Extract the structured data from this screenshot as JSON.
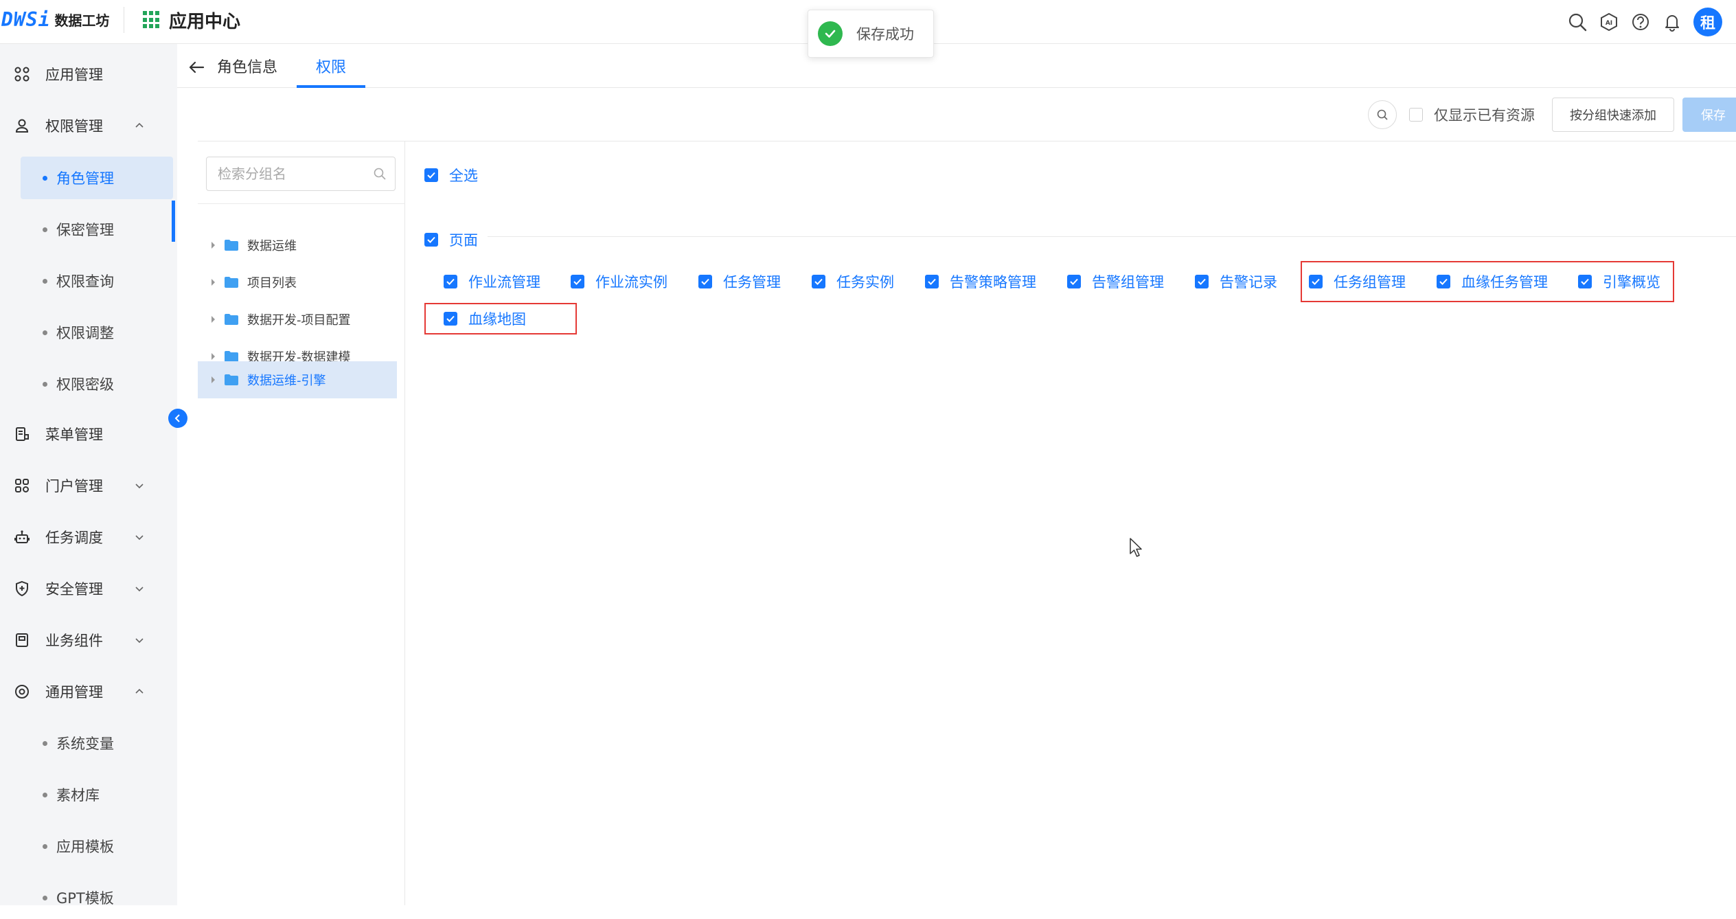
{
  "header": {
    "logo_mark": "DWSi",
    "logo_text": "数据工坊",
    "app_center": "应用中心",
    "avatar": "租"
  },
  "toast": {
    "message": "保存成功"
  },
  "sidebar": {
    "items": [
      {
        "label": "应用管理"
      },
      {
        "label": "权限管理"
      },
      {
        "label": "菜单管理"
      },
      {
        "label": "门户管理"
      },
      {
        "label": "任务调度"
      },
      {
        "label": "安全管理"
      },
      {
        "label": "业务组件"
      },
      {
        "label": "通用管理"
      }
    ],
    "permission_children": [
      "角色管理",
      "保密管理",
      "权限查询",
      "权限调整",
      "权限密级"
    ],
    "general_children": [
      "系统变量",
      "素材库",
      "应用模板",
      "GPT模板"
    ]
  },
  "tabs": [
    "角色信息",
    "权限"
  ],
  "toolbar": {
    "only_existing": "仅显示已有资源",
    "quick_add": "按分组快速添加",
    "save": "保存"
  },
  "group_search": {
    "placeholder": "检索分组名"
  },
  "groups": [
    "数据运维",
    "项目列表",
    "数据开发-项目配置",
    "数据开发-数据建模",
    "数据运维-引擎"
  ],
  "permissions": {
    "select_all": "全选",
    "section": "页面",
    "items": [
      "作业流管理",
      "作业流实例",
      "任务管理",
      "任务实例",
      "告警策略管理",
      "告警组管理",
      "告警记录",
      "任务组管理",
      "血缘任务管理",
      "引擎概览",
      "血缘地图"
    ]
  },
  "colors": {
    "accent": "#1677ff",
    "success": "#2fb84f",
    "highlight_border": "#e53935",
    "app_grid": "#22a559"
  }
}
